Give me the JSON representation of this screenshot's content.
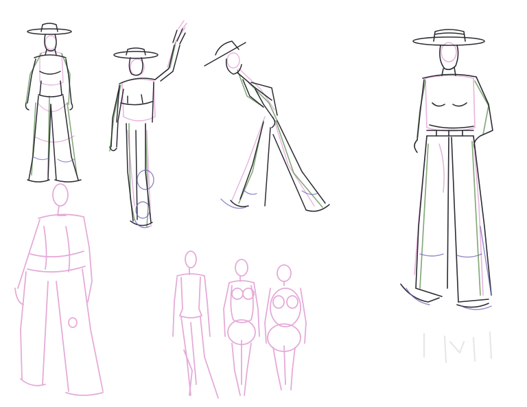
{
  "artwork": {
    "subject": "figure-sketch-sheet",
    "colors": {
      "background": "#ffffff",
      "line_dark": "#2a2a33",
      "line_green": "#6f9a63",
      "line_pink": "#e4a6d6",
      "line_blue": "#6a63b8",
      "line_faint": "#e7e7e7"
    },
    "figures": [
      {
        "name": "standing-hat-figure"
      },
      {
        "name": "waving-hat-figure"
      },
      {
        "name": "bowing-hat-figure"
      },
      {
        "name": "large-hat-figure"
      },
      {
        "name": "pink-gesture-figure"
      },
      {
        "name": "pink-body-study-slim"
      },
      {
        "name": "pink-body-study-curvy"
      },
      {
        "name": "pink-body-study-round"
      },
      {
        "name": "faint-sketch-marks"
      }
    ]
  }
}
